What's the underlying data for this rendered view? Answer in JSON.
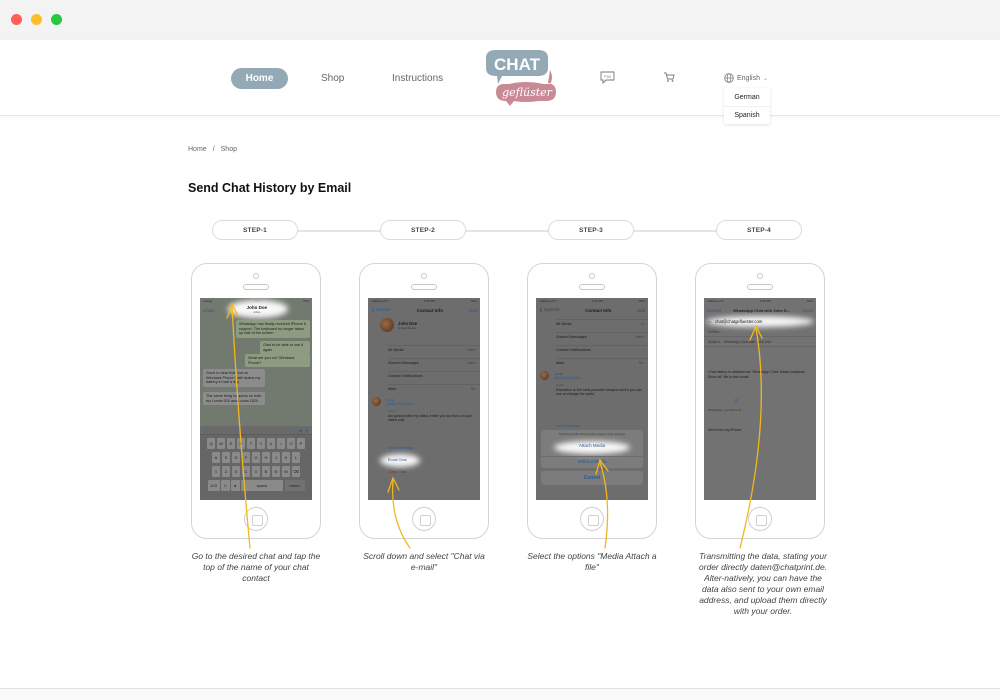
{
  "window": {
    "controls": [
      "close",
      "minimize",
      "maximize"
    ]
  },
  "header": {
    "nav": [
      {
        "label": "Home",
        "active": true
      },
      {
        "label": "Shop",
        "active": false
      },
      {
        "label": "Instructions",
        "active": false
      }
    ],
    "logo": {
      "top_word": "CHAT",
      "bottom_word": "geflüster",
      "colors": {
        "top": "#93a9b6",
        "bottom": "#c98995"
      }
    },
    "icons": {
      "faq_label": "Faq",
      "cart": "cart-icon"
    },
    "language": {
      "current": "English",
      "options": [
        "German",
        "Spanish"
      ]
    }
  },
  "breadcrumb": {
    "items": [
      "Home",
      "Shop"
    ],
    "separator": "/"
  },
  "page_title": "Send Chat History by Email",
  "accent_color": "#f2b71c",
  "steps": [
    {
      "label": "STEP-1",
      "caption": "Go to the desired chat and tap the top of the name of your chat contact",
      "screen": {
        "status": {
          "carrier": "orange",
          "time": "09:07",
          "battery": "76%"
        },
        "back": "Chats",
        "title": "John Doe",
        "subtitle": "online",
        "messages": [
          {
            "dir": "out",
            "text": "WhatsApp has finally received iPhone 6 support. The keyboard no longer takes up half of the screen"
          },
          {
            "dir": "out",
            "text": "Glad to be able to use it again"
          },
          {
            "dir": "out",
            "text": "What are you on? Windows Phone?"
          },
          {
            "dir": "in",
            "text": "Good to hear that, but on Windows Phone it still drains my battery in half a day"
          },
          {
            "dir": "in",
            "text": "The same thing happens on both my Lumia 920 and Lumia 1520"
          }
        ],
        "keyboard": {
          "rows": [
            [
              "Q",
              "W",
              "E",
              "R",
              "T",
              "Y",
              "U",
              "I",
              "O",
              "P"
            ],
            [
              "A",
              "S",
              "D",
              "F",
              "G",
              "H",
              "J",
              "K",
              "L"
            ],
            [
              "⇧",
              "Z",
              "X",
              "C",
              "V",
              "B",
              "N",
              "M",
              "⌫"
            ]
          ],
          "space": "space",
          "return": "return"
        }
      }
    },
    {
      "label": "STEP-2",
      "caption": "Scroll down and select \"Chat via e-mail\"",
      "screen": {
        "status": {
          "carrier": "Vodafone IN",
          "time": "5:43 PM",
          "battery": "54%"
        },
        "back": "Naresh",
        "title": "Contact Info",
        "action": "Edit",
        "contact_name": "John Doe",
        "contact_sub": "United States",
        "rows": [
          {
            "label": "All Media",
            "value": "None"
          },
          {
            "label": "Starred Messages",
            "value": "None"
          },
          {
            "label": "Custom Notifications",
            "value": ""
          },
          {
            "label": "Mute",
            "value": "No"
          }
        ],
        "phone_label": "mobile",
        "phone": "(888)-573-8108",
        "status_label": "status",
        "status_text": "Am gonna make my status, better you too focus on your status only",
        "actions": [
          "Send Message",
          "Email Chat",
          "Clear Chat"
        ]
      }
    },
    {
      "label": "STEP-3",
      "caption": "Select the options \"Media Attach a file\"",
      "screen": {
        "status": {
          "carrier": "Vodafone IN",
          "time": "4:31 PM",
          "battery": "69%"
        },
        "back": "Jignesh",
        "title": "Contact Info",
        "action": "Edit",
        "rows": [
          {
            "label": "All Media",
            "value": "8"
          },
          {
            "label": "Starred Messages",
            "value": "None"
          },
          {
            "label": "Custom Notifications",
            "value": ""
          },
          {
            "label": "Mute",
            "value": "No"
          }
        ],
        "phone_label": "mobile",
        "phone": "(985)-573-8108",
        "status_label": "status",
        "status_text": "Education is the most powerful weapon,which you can use to change the world",
        "peek": "Send Message",
        "sheet_note": "Attaching Media will generate a larger email message",
        "sheet_options": [
          "Attach Media",
          "Without Media"
        ],
        "cancel": "Cancel"
      }
    },
    {
      "label": "STEP-4",
      "caption": "Transmitting the data, stating your order directly daten@chatprint.de. Alter-natively, you can have the data also sent to your own email address, and upload them directly with your order.",
      "screen": {
        "status": {
          "carrier": "Vodafone IN",
          "time": "5:44 PM",
          "battery": "54%"
        },
        "cancel": "Cancel",
        "title": "WhatsApp Chat with John D...",
        "send": "Send",
        "to_label": "To:",
        "to_value": "chat@chatgefluester.com",
        "cc_label": "Cc/Bcc:",
        "subject_label": "Subject:",
        "subject_value": "WhatsApp Chat with John Doe",
        "body": "Chat history is attached as \"WhatsApp Chat: Marta vodafone Store.txt\" file to this email.",
        "attachment": "WhatsApp...one Store.txt",
        "signature": "Sent from my iPhone"
      }
    }
  ]
}
